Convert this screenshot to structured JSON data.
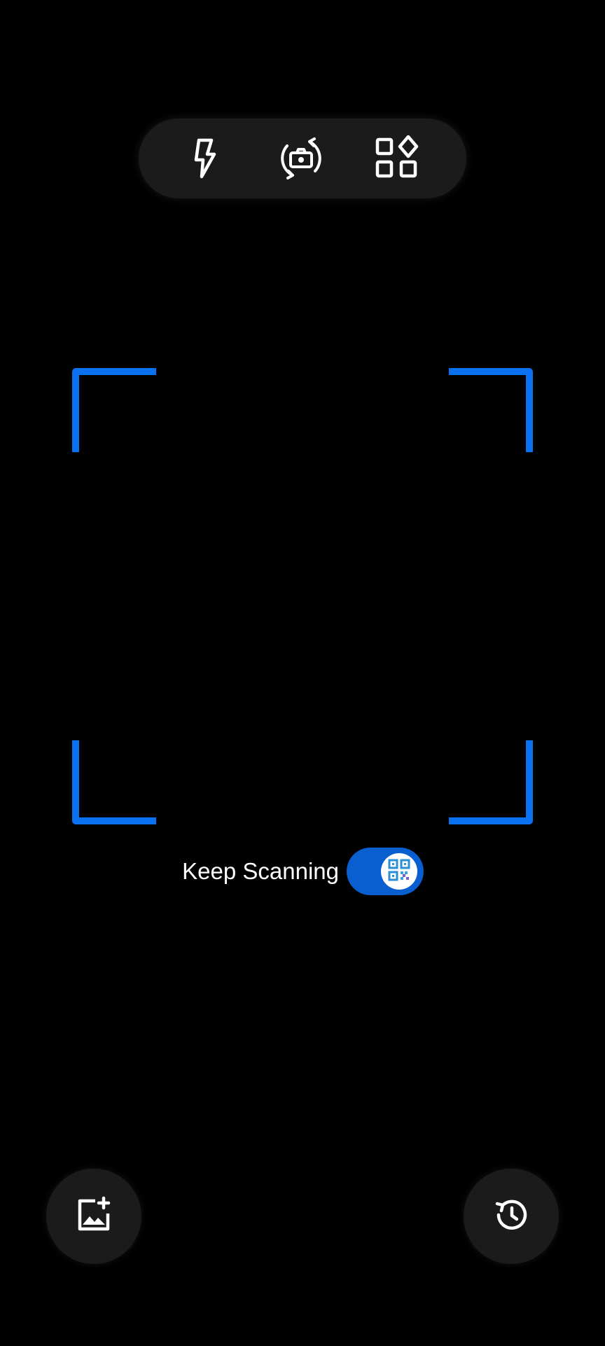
{
  "toolbar": {
    "icons": [
      "flash-icon",
      "rotate-camera-icon",
      "apps-icon"
    ]
  },
  "scan_frame": {
    "color": "#0a72f0"
  },
  "keep_scanning": {
    "label": "Keep Scanning",
    "enabled": true,
    "toggle_color": "#0a5fd0",
    "knob_icon": "qr-code-icon"
  },
  "bottom_actions": {
    "left_icon": "add-image-icon",
    "right_icon": "history-icon"
  },
  "colors": {
    "background": "#000000",
    "button_background": "#1b1b1b",
    "icon": "#ffffff"
  }
}
